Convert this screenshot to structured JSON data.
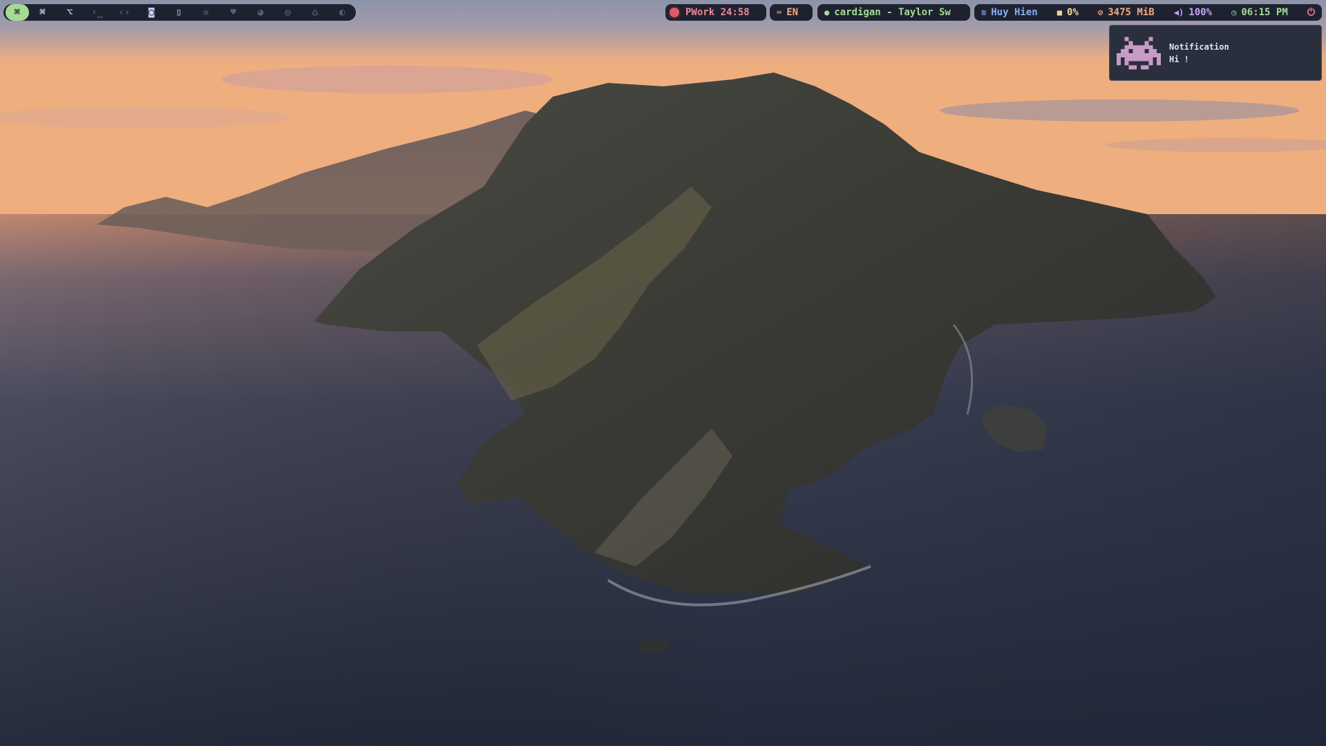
{
  "workspaces": [
    {
      "glyph": "⌘",
      "state": "active"
    },
    {
      "glyph": "⌘",
      "state": "occupied"
    },
    {
      "glyph": "⌥",
      "state": "occupied"
    },
    {
      "glyph": "›_",
      "state": "empty"
    },
    {
      "glyph": "‹›",
      "state": "empty"
    },
    {
      "glyph": "◙",
      "state": "occupied"
    },
    {
      "glyph": "▯",
      "state": "occupied"
    },
    {
      "glyph": "✲",
      "state": "empty"
    },
    {
      "glyph": "♥",
      "state": "empty"
    },
    {
      "glyph": "◕",
      "state": "empty"
    },
    {
      "glyph": "◎",
      "state": "empty"
    },
    {
      "glyph": "⌂",
      "state": "empty"
    },
    {
      "glyph": "◐",
      "state": "empty"
    }
  ],
  "status": {
    "pomodoro": "PWork 24:58",
    "keyboard_icon": "keyboard-icon",
    "language": "EN",
    "music": "cardigan - Taylor Sw",
    "wifi": "Huy Hien",
    "cpu": "0%",
    "memory": "3475 MiB",
    "volume": "100%",
    "clock": "06:15 PM"
  },
  "notification": {
    "title": "Notification",
    "body": "Hi !",
    "icon": "space-invader-icon"
  },
  "colors": {
    "bar_bg": "#1e2230",
    "active_ws": "#a6da95",
    "pomodoro": "#ed8796",
    "language": "#f5a97f",
    "music": "#a6da95",
    "wifi": "#8aadf4",
    "cpu": "#eed49f",
    "memory": "#f5a97f",
    "volume": "#c6a0f6",
    "clock": "#a6da95",
    "power": "#ed8796"
  }
}
